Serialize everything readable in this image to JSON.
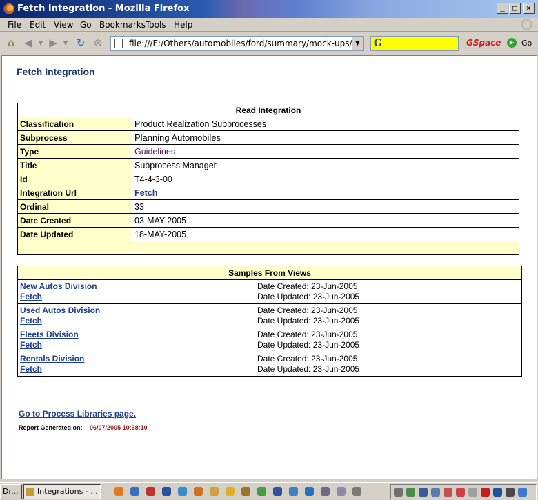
{
  "window": {
    "title": "Fetch Integration - Mozilla Firefox",
    "minimize_icon": "minimize-icon",
    "maximize_icon": "maximize-icon",
    "close_icon": "close-icon"
  },
  "menubar": {
    "items": [
      "File",
      "Edit",
      "View",
      "Go",
      "Bookmarks",
      "Tools",
      "Help"
    ]
  },
  "toolbar": {
    "url": "file:///E:/Others/automobiles/ford/summary/mock-ups/Integrations",
    "search_logo": "G",
    "gspace_label": "GSpace",
    "go_label": "Go",
    "icons": [
      "home-icon",
      "back-icon",
      "forward-icon",
      "reload-icon",
      "stop-icon"
    ]
  },
  "page": {
    "title": "Fetch Integration",
    "integration_table": {
      "header": "Read Integration",
      "rows": [
        {
          "label": "Classification",
          "value": "Product Realization Subprocesses"
        },
        {
          "label": "Subprocess",
          "value": "Planning Automobiles"
        },
        {
          "label": "Type",
          "value": "Guidelines"
        },
        {
          "label": "Title",
          "value": "Subprocess Manager"
        },
        {
          "label": "Id",
          "value": "T4-4-3-00"
        },
        {
          "label": "Integration Url",
          "value": "Fetch"
        },
        {
          "label": "Ordinal",
          "value": "33"
        },
        {
          "label": "Date Created",
          "value": "03-MAY-2005"
        },
        {
          "label": "Date Updated",
          "value": "18-MAY-2005"
        }
      ]
    },
    "samples_table": {
      "header": "Samples From Views",
      "rows": [
        {
          "name": "New Autos Division",
          "fetch": "Fetch",
          "created": "Date Created: 23-Jun-2005",
          "updated": "Date Updated: 23-Jun-2005"
        },
        {
          "name": "Used Autos Division",
          "fetch": "Fetch",
          "created": "Date Created: 23-Jun-2005",
          "updated": "Date Updated: 23-Jun-2005"
        },
        {
          "name": "Fleets Division",
          "fetch": "Fetch",
          "created": "Date Created: 23-Jun-2005",
          "updated": "Date Updated: 23-Jun-2005"
        },
        {
          "name": "Rentals Division ",
          "fetch": "Fetch",
          "created": "Date Created: 23-Jun-2005",
          "updated": "Date Updated: 23-Jun-2005"
        }
      ]
    },
    "process_link": "Go to Process Libraries page.",
    "report_label": "Report Generated on:",
    "report_timestamp": "06/07/2005 10:38:10"
  },
  "taskbar": {
    "items": [
      {
        "label": "Dr..."
      },
      {
        "label": "Integrations - ..."
      }
    ]
  }
}
